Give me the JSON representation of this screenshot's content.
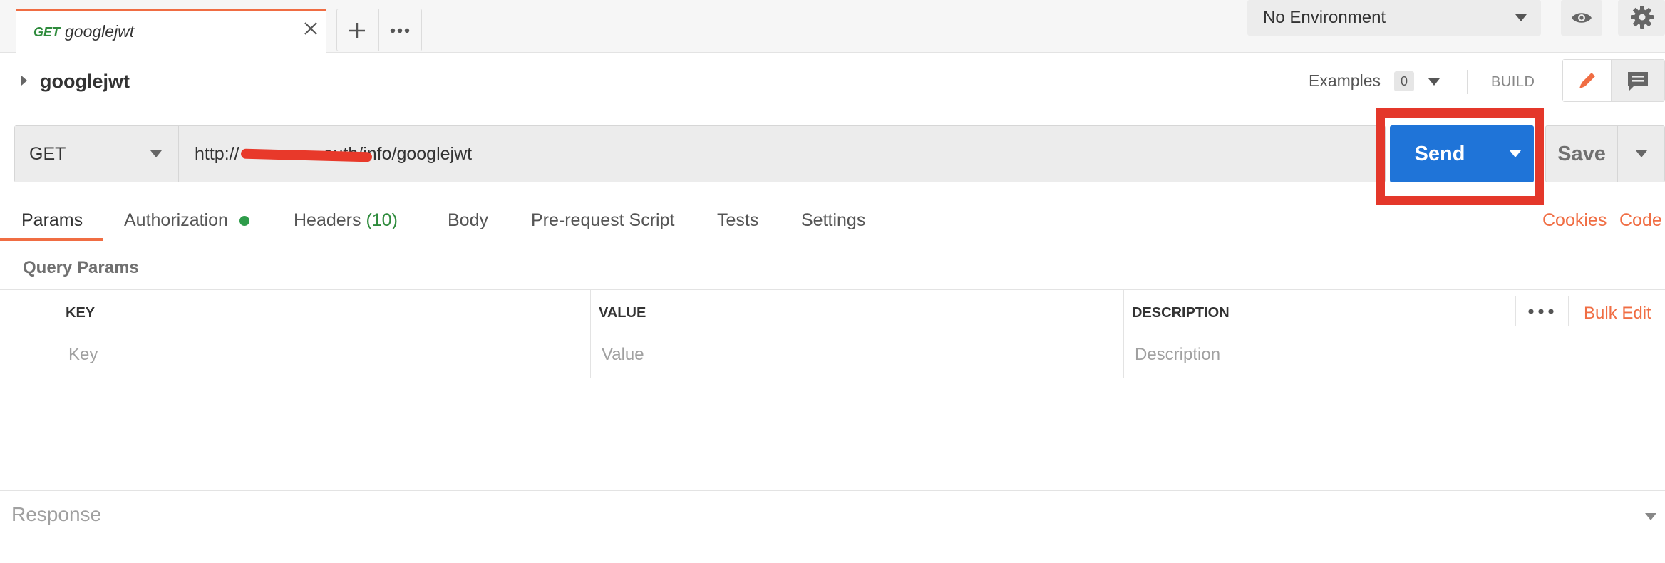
{
  "tab": {
    "method": "GET",
    "name": "googlejwt"
  },
  "environment": {
    "selected": "No Environment"
  },
  "request": {
    "title": "googlejwt",
    "examples_label": "Examples",
    "examples_count": "0",
    "mode_label": "BUILD",
    "method": "GET",
    "url": "http://                 auth/info/googlejwt"
  },
  "actions": {
    "send_label": "Send",
    "save_label": "Save"
  },
  "request_tabs": [
    {
      "label": "Params"
    },
    {
      "label": "Authorization"
    },
    {
      "label": "Headers",
      "count": "(10)"
    },
    {
      "label": "Body"
    },
    {
      "label": "Pre-request Script"
    },
    {
      "label": "Tests"
    },
    {
      "label": "Settings"
    }
  ],
  "links": {
    "cookies": "Cookies",
    "code": "Code"
  },
  "query_params": {
    "title": "Query Params",
    "columns": [
      "KEY",
      "VALUE",
      "DESCRIPTION"
    ],
    "placeholders": [
      "Key",
      "Value",
      "Description"
    ],
    "bulk_edit": "Bulk Edit"
  },
  "response": {
    "label": "Response"
  },
  "colors": {
    "accent": "#f06d43",
    "send_blue": "#1f74d8",
    "highlight_red": "#e4372a",
    "auth_status_green": "#2e9c4a"
  },
  "icons": [
    "close-icon",
    "plus-icon",
    "more-icon",
    "eye-icon",
    "gear-icon",
    "pencil-icon",
    "comment-icon",
    "chevron-down-icon",
    "caret-right-icon"
  ]
}
